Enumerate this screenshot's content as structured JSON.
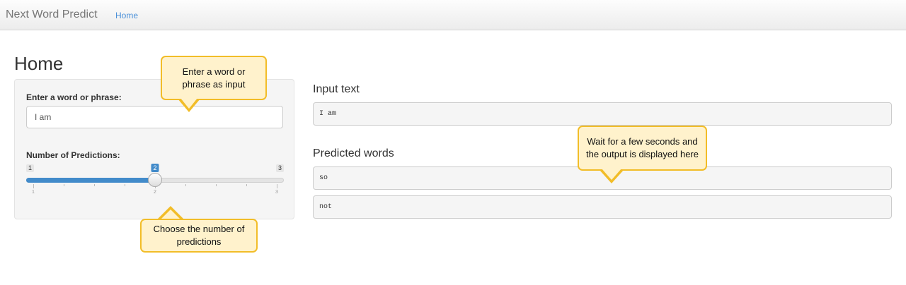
{
  "navbar": {
    "brand": "Next Word Predict",
    "home_link": "Home"
  },
  "page": {
    "title": "Home"
  },
  "input_panel": {
    "text_label": "Enter a word or phrase:",
    "text_value": "I am",
    "slider_label": "Number of Predictions:",
    "slider": {
      "min": 1,
      "max": 3,
      "value": 2,
      "min_label": "1",
      "max_label": "3",
      "value_label": "2",
      "tick_labels": [
        "1",
        "2",
        "3"
      ]
    }
  },
  "output": {
    "input_title": "Input text",
    "input_value": "I am",
    "predicted_title": "Predicted words",
    "predictions": [
      "so",
      "not"
    ]
  },
  "callouts": {
    "input_hint": "Enter a word or phrase as input",
    "slider_hint": "Choose the number of predictions",
    "output_hint": "Wait for a few seconds and the output is displayed here"
  },
  "colors": {
    "accent": "#428bca",
    "callout_fill": "#fff2cc",
    "callout_border": "#f2bd28"
  }
}
